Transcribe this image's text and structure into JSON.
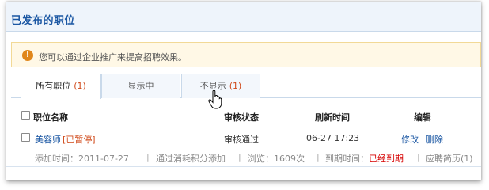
{
  "panel": {
    "title": "已发布的职位"
  },
  "notice": {
    "icon": "info-icon",
    "text": "您可以通过企业推广来提高招聘效果。"
  },
  "tabs": [
    {
      "label": "所有职位",
      "count": "(1)",
      "active": true
    },
    {
      "label": "显示中",
      "count": "",
      "active": false
    },
    {
      "label": "不显示",
      "count": "(1)",
      "active": false
    }
  ],
  "table": {
    "headers": {
      "name": "职位名称",
      "status": "审核状态",
      "refresh_time": "刷新时间",
      "edit": "编辑"
    },
    "rows": [
      {
        "title": "美容师",
        "state": "[已暂停]",
        "status": "审核通过",
        "refresh_time": "06-27 17:23",
        "edit_label": "修改",
        "delete_label": "删除",
        "added": "添加时间：2011-07-27",
        "method": "通过消耗积分添加",
        "views": "浏览：1609次",
        "expire_label": "到期时间：",
        "expire_value": "已经到期",
        "applications": "应聘简历(1)"
      }
    ]
  },
  "colors": {
    "accent": "#1b57a3",
    "warning": "#d04a1a",
    "expired": "#d60000"
  }
}
